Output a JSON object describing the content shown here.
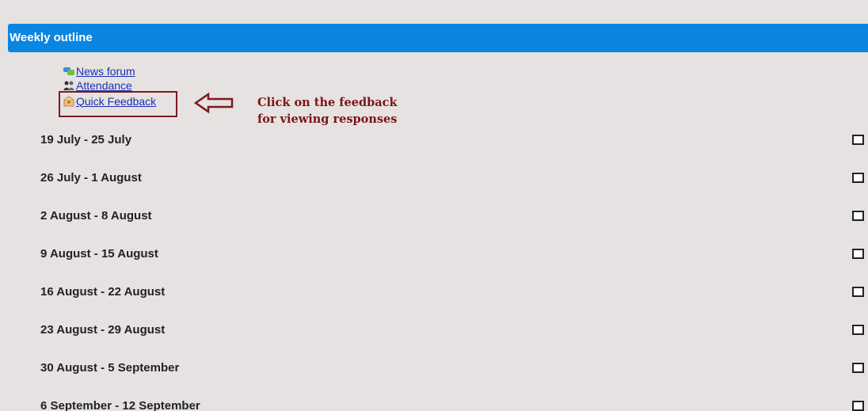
{
  "section": {
    "title": "Weekly outline"
  },
  "activities": [
    {
      "label": "News forum",
      "icon": "forum-icon"
    },
    {
      "label": "Attendance",
      "icon": "attendance-icon"
    },
    {
      "label": "Quick Feedback",
      "icon": "feedback-icon"
    }
  ],
  "annotation": {
    "line1": "Click on the feedback",
    "line2": "for viewing responses",
    "color": "#7b1414"
  },
  "weeks": [
    "19 July - 25 July",
    "26 July - 1 August",
    "2 August - 8 August",
    "9 August - 15 August",
    "16 August - 22 August",
    "23 August - 29 August",
    "30 August - 5 September",
    "6 September - 12 September"
  ],
  "colors": {
    "header": "#0a85e0",
    "background": "#e7e2e2",
    "link": "#1a2fb5"
  }
}
